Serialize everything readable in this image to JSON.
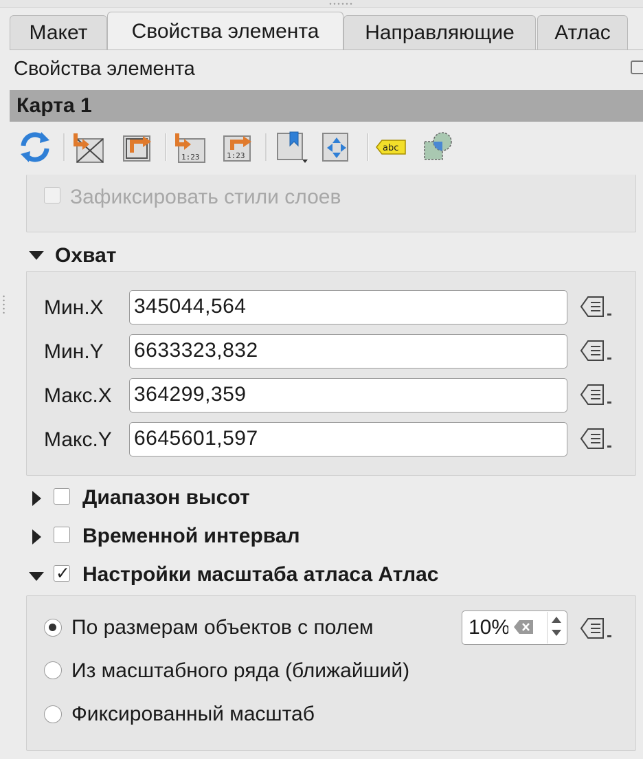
{
  "tabs": [
    {
      "label": "Макет",
      "active": false
    },
    {
      "label": "Свойства элемента",
      "active": true
    },
    {
      "label": "Направляющие",
      "active": false
    },
    {
      "label": "Атлас",
      "active": false
    }
  ],
  "panel_title": "Свойства элемента",
  "item_name": "Карта 1",
  "toolbar": {
    "icons": [
      "refresh-icon",
      "set-extent-from-canvas-icon",
      "view-extent-in-canvas-icon",
      "set-scale-from-canvas-icon",
      "view-scale-in-canvas-icon",
      "bookmark-icon",
      "move-content-icon",
      "label-abc-icon",
      "clip-overlay-icon"
    ]
  },
  "lock_styles": {
    "label": "Зафиксировать стили слоев",
    "checked": false,
    "enabled": false
  },
  "extent": {
    "title": "Охват",
    "expanded": true,
    "fields": [
      {
        "label": "Мин.X",
        "value": "345044,564"
      },
      {
        "label": "Мин.Y",
        "value": "6633323,832"
      },
      {
        "label": "Макс.X",
        "value": "364299,359"
      },
      {
        "label": "Макс.Y",
        "value": "6645601,597"
      }
    ]
  },
  "elevation_range": {
    "title": "Диапазон высот",
    "checked": false,
    "expanded": false
  },
  "temporal_range": {
    "title": "Временной интервал",
    "checked": false,
    "expanded": false
  },
  "atlas_scale": {
    "title": "Настройки масштаба атласа Атлас",
    "checked": true,
    "expanded": true,
    "options": [
      {
        "label": "По размерам объектов с полем",
        "selected": true
      },
      {
        "label": "Из масштабного ряда (ближайший)",
        "selected": false
      },
      {
        "label": "Фиксированный масштаб",
        "selected": false
      }
    ],
    "margin_value": "10%"
  }
}
